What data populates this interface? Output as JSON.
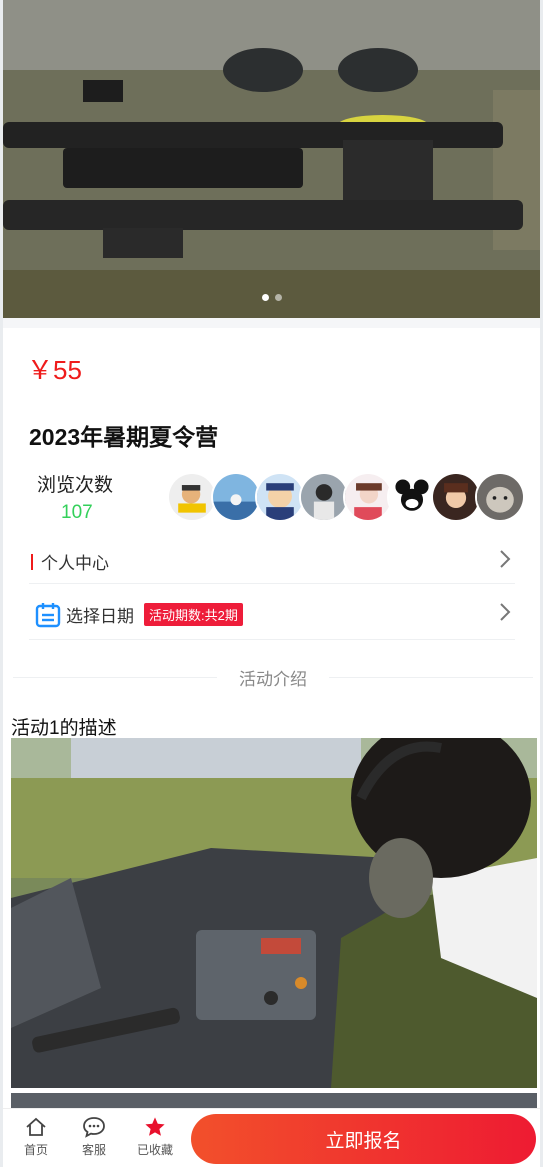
{
  "banner": {
    "slide_count": 2,
    "active_slide": 1
  },
  "product": {
    "price": "￥55",
    "title": "2023年暑期夏令营",
    "views_label": "浏览次数",
    "views_count": "107"
  },
  "avatars": [
    "avatar-1",
    "avatar-2",
    "avatar-3",
    "avatar-4",
    "avatar-5",
    "avatar-6",
    "avatar-7",
    "avatar-8"
  ],
  "rows": {
    "personal_center": "个人中心",
    "select_date": "选择日期",
    "period_badge": "活动期数:共2期"
  },
  "intro": {
    "heading": "活动介绍",
    "description": "活动1的描述"
  },
  "tabbar": {
    "home": "首页",
    "service": "客服",
    "favorited": "已收藏",
    "signup": "立即报名"
  },
  "colors": {
    "accent": "#ef1b1b",
    "views": "#33d05a",
    "cta_start": "#f2502b",
    "cta_end": "#ee1b32"
  },
  "icons": {
    "home": "home-icon",
    "service": "chat-bubble-icon",
    "favorited": "star-icon",
    "date": "calendar-icon",
    "chevron": "chevron-right-icon"
  }
}
